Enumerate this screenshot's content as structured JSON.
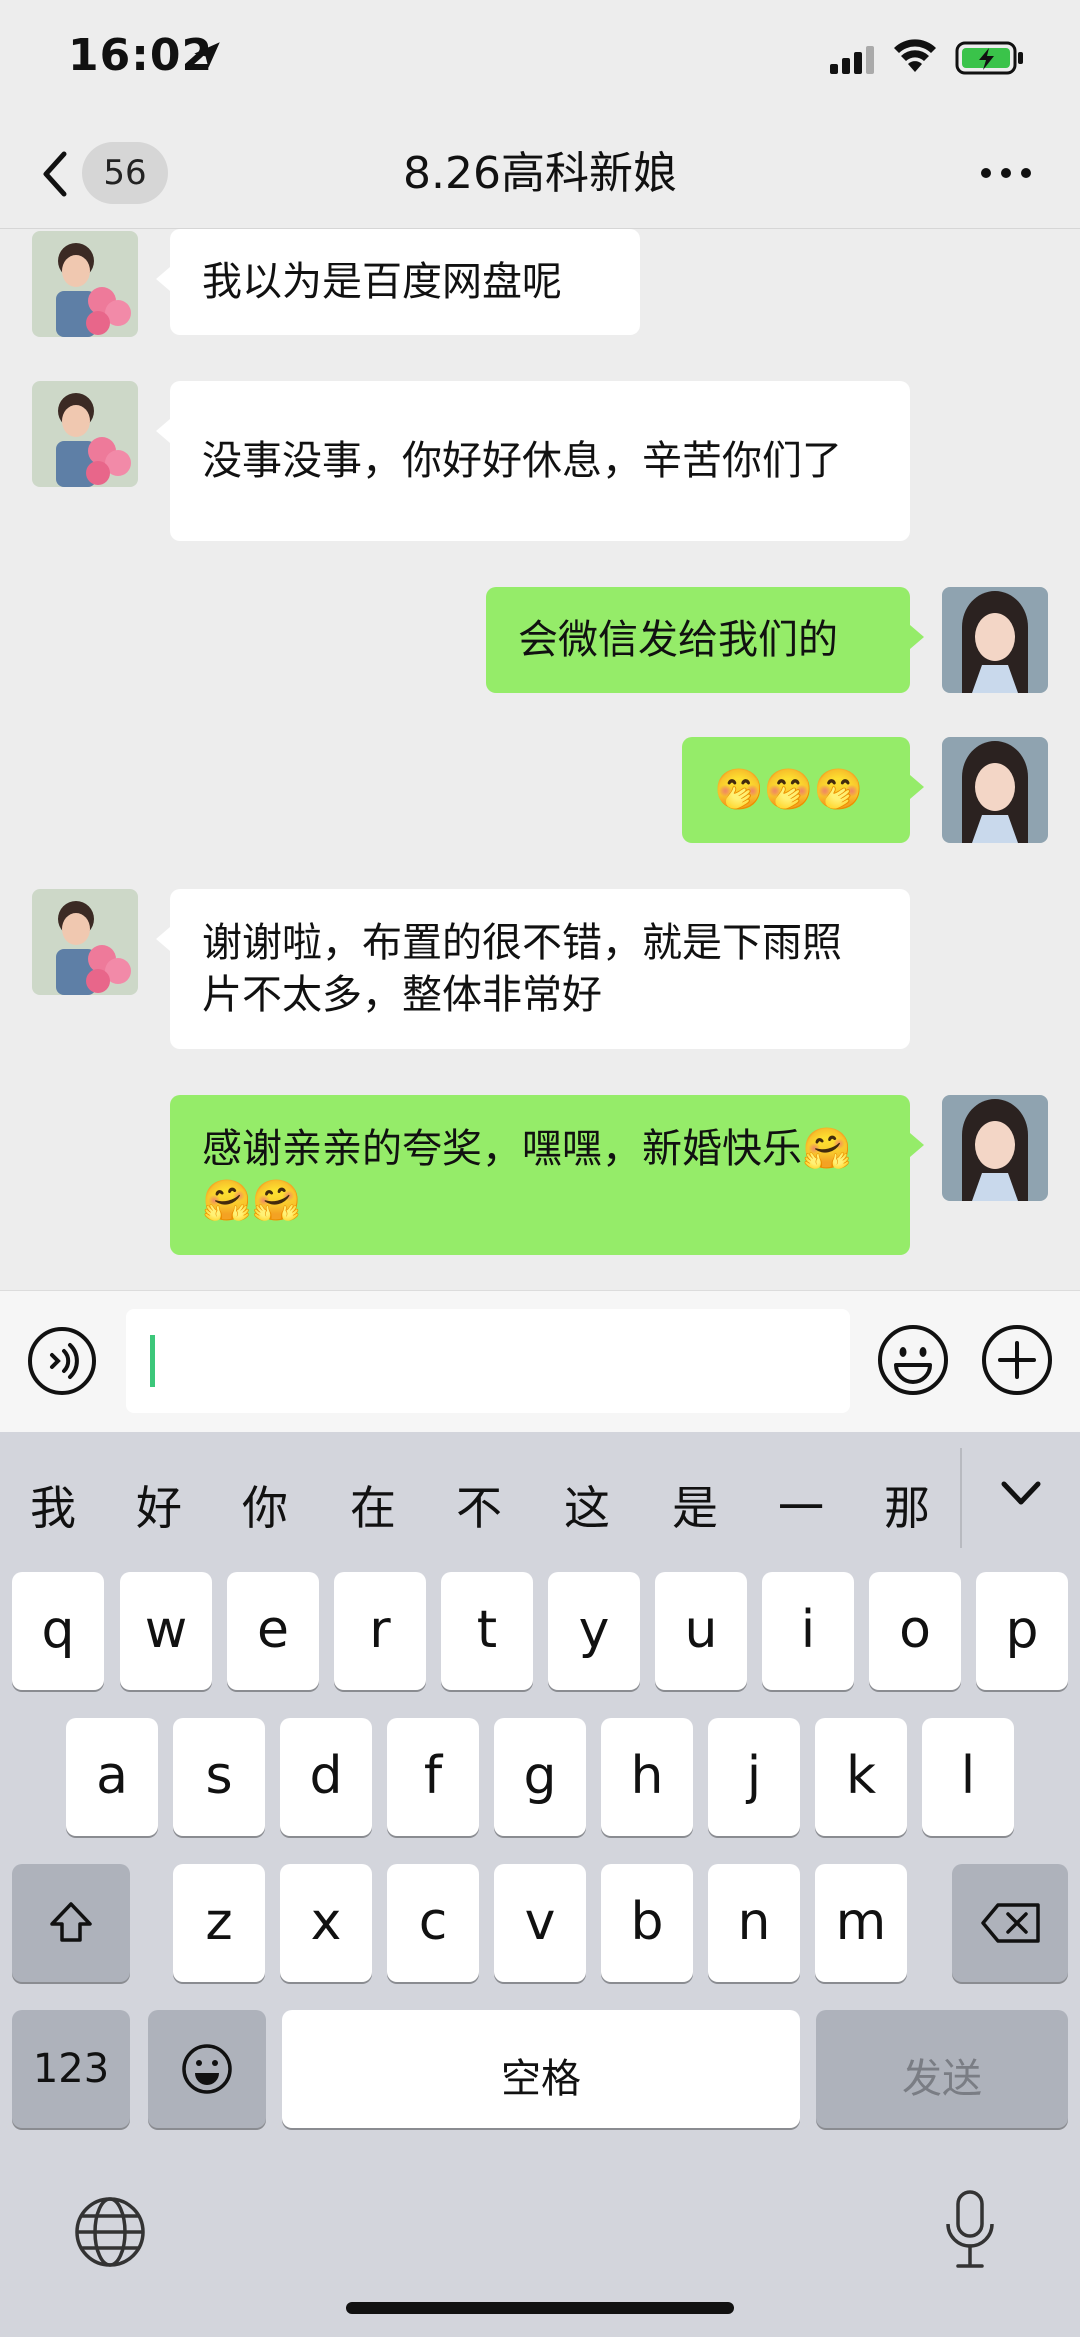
{
  "status_bar": {
    "time": "16:02"
  },
  "nav": {
    "unread_count": "56",
    "title": "8.26高科新娘"
  },
  "messages": [
    {
      "side": "left",
      "text": "我以为是百度网盘呢"
    },
    {
      "side": "left",
      "text": "没事没事，你好好休息，辛苦你们了"
    },
    {
      "side": "right",
      "text": "会微信发给我们的"
    },
    {
      "side": "right",
      "text": "🤭🤭🤭"
    },
    {
      "side": "left",
      "text": "谢谢啦，布置的很不错，就是下雨照片不太多，整体非常好"
    },
    {
      "side": "right",
      "text": "感谢亲亲的夸奖，嘿嘿，新婚快乐🤗🤗🤗"
    }
  ],
  "input": {
    "value": ""
  },
  "keyboard": {
    "candidates": [
      "我",
      "好",
      "你",
      "在",
      "不",
      "这",
      "是",
      "一",
      "那"
    ],
    "row1": [
      "q",
      "w",
      "e",
      "r",
      "t",
      "y",
      "u",
      "i",
      "o",
      "p"
    ],
    "row2": [
      "a",
      "s",
      "d",
      "f",
      "g",
      "h",
      "j",
      "k",
      "l"
    ],
    "row3": [
      "z",
      "x",
      "c",
      "v",
      "b",
      "n",
      "m"
    ],
    "numbers_key": "123",
    "space_key": "空格",
    "send_key": "发送"
  },
  "colors": {
    "background": "#ededed",
    "my_bubble": "#95ec69",
    "their_bubble": "#ffffff",
    "keyboard": "#d3d5dc"
  }
}
